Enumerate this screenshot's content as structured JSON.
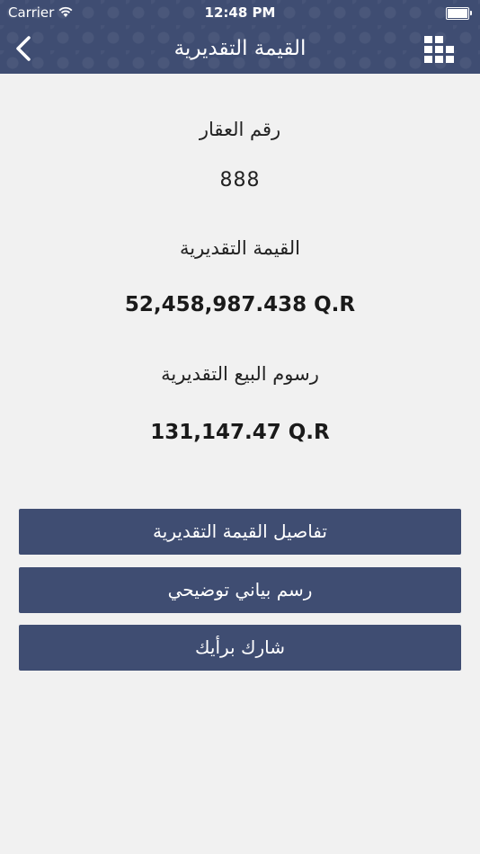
{
  "status_bar": {
    "carrier": "Carrier",
    "time": "12:48 PM"
  },
  "header": {
    "title": "القيمة التقديرية"
  },
  "property": {
    "number_label": "رقم العقار",
    "number_value": "888",
    "estimated_value_label": "القيمة التقديرية",
    "estimated_value": "52,458,987.438 Q.R",
    "sale_fees_label": "رسوم البيع التقديرية",
    "sale_fees_value": "131,147.47 Q.R"
  },
  "buttons": {
    "details": "تفاصيل القيمة التقديرية",
    "chart": "رسم بياني توضيحي",
    "feedback": "شارك برأيك"
  },
  "colors": {
    "header_bg": "#3f4d72",
    "button_bg": "#3f4d72",
    "page_bg": "#f1f1f1"
  },
  "icons": {
    "back": "chevron-left-icon",
    "menu": "grid-icon",
    "wifi": "wifi-icon",
    "battery": "battery-icon"
  }
}
